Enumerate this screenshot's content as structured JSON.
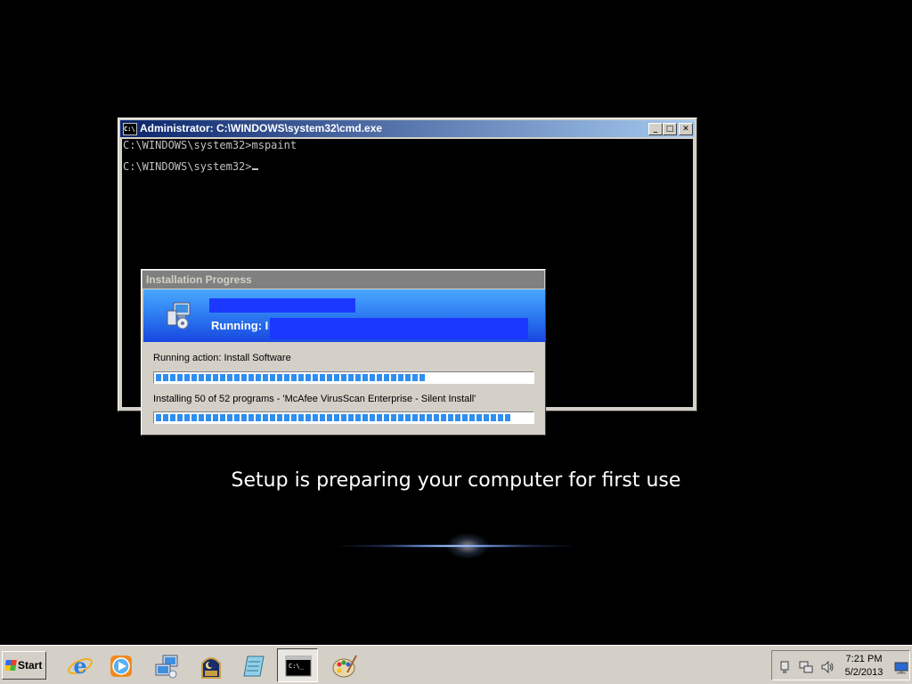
{
  "cmd_window": {
    "title": "Administrator: C:\\WINDOWS\\system32\\cmd.exe",
    "icon_text": "C:\\",
    "buttons": {
      "minimize": "_",
      "maximize": "□",
      "close": "✕"
    },
    "lines": [
      "C:\\WINDOWS\\system32>mspaint",
      "C:\\WINDOWS\\system32>"
    ]
  },
  "install_dialog": {
    "title": "Installation Progress",
    "banner_running": "Running: I",
    "action_text": "Running action: Install Software",
    "action_progress": 0.72,
    "programs_text": "Installing 50 of 52 programs - 'McAfee VirusScan Enterprise - Silent Install'",
    "programs_progress": 0.945,
    "progress_color": "#2f8ff0",
    "banner_color": "#2f7ff2"
  },
  "setup_message": "Setup is preparing your computer for first use",
  "taskbar": {
    "start_label": "Start",
    "buttons": [
      {
        "name": "internet-explorer",
        "icon": "ie-icon"
      },
      {
        "name": "media-player",
        "icon": "media-player-icon"
      },
      {
        "name": "network",
        "icon": "network-computers-icon"
      },
      {
        "name": "night-app",
        "icon": "moon-window-icon"
      },
      {
        "name": "notepad",
        "icon": "notepad-icon"
      },
      {
        "name": "command-prompt",
        "icon": "cmd-icon",
        "active": true
      },
      {
        "name": "paint",
        "icon": "paint-palette-icon"
      }
    ],
    "tray": {
      "time": "7:21 PM",
      "date": "5/2/2013",
      "icons": [
        "usb-icon",
        "network-icon",
        "volume-icon",
        "show-desktop-icon"
      ]
    }
  }
}
